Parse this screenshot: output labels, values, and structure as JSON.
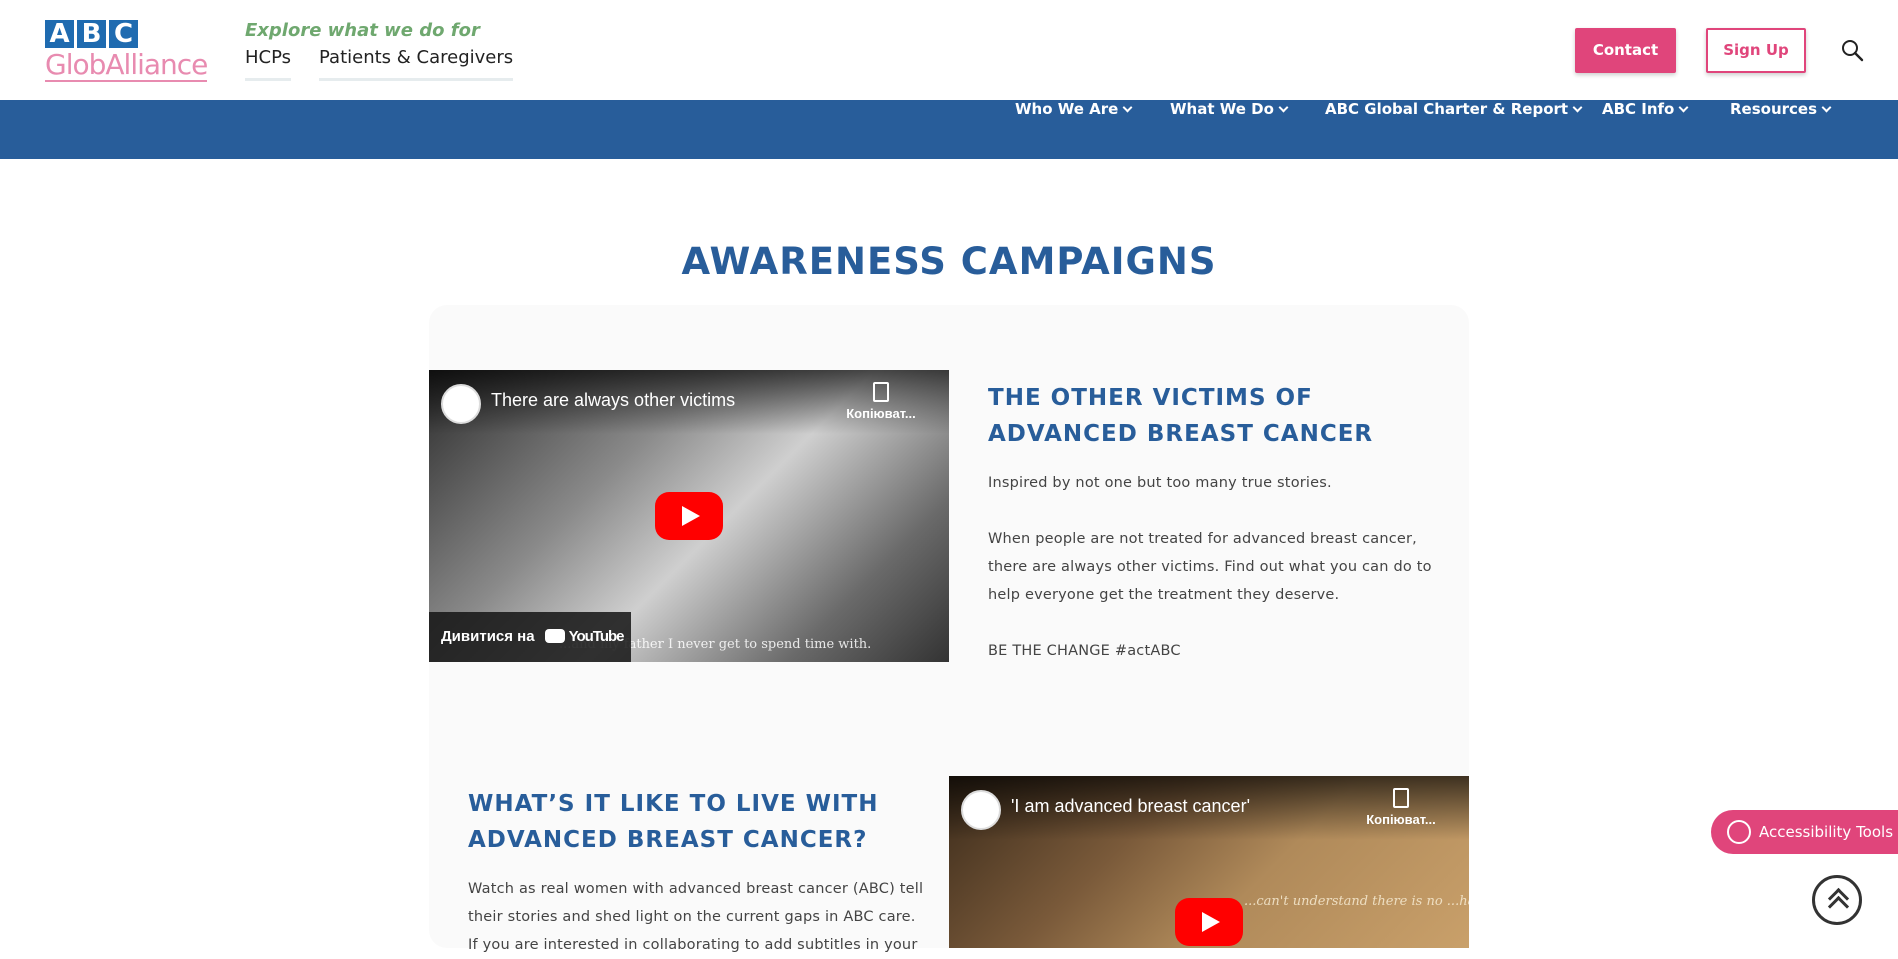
{
  "header": {
    "logo": {
      "top": "ABC",
      "bottom": "GlobAlliance"
    },
    "explore_label": "Explore what we do for",
    "audiences": [
      "HCPs",
      "Patients & Caregivers"
    ],
    "contact_label": "Contact",
    "signup_label": "Sign Up",
    "search_icon": "search-icon"
  },
  "nav": {
    "items": [
      {
        "label": "Who We Are"
      },
      {
        "label": "What We Do"
      },
      {
        "label": "ABC Global Charter & Report"
      },
      {
        "label": "ABC Info"
      },
      {
        "label": "Resources"
      }
    ]
  },
  "main": {
    "title": "AWARENESS CAMPAIGNS",
    "campaigns": [
      {
        "video": {
          "title": "There are always other victims",
          "copy_label": "Копіюват...",
          "watch_label": "Дивитися на",
          "youtube_label": "YouTube",
          "subtitle": "...and my father I never get to spend time with."
        },
        "heading_line1": "THE OTHER VICTIMS OF",
        "heading_line2": "ADVANCED BREAST CANCER",
        "para1": "Inspired by not one but too many true stories.",
        "para2_l1": "When people are not treated for advanced breast cancer,",
        "para2_l2": "there are always other victims. Find out what you can do to",
        "para2_l3": "help everyone get the treatment they deserve.",
        "para3": "BE THE CHANGE #actABC"
      },
      {
        "video": {
          "title": "'I am advanced breast cancer'",
          "copy_label": "Копіюват...",
          "subtitle": "...can't understand there is no ...happy ending....no getting better"
        },
        "heading_line1": "WHAT’S IT LIKE TO LIVE WITH",
        "heading_line2": "ADVANCED BREAST CANCER?",
        "para1_l1": "Watch as real women with advanced breast cancer (ABC) tell",
        "para1_l2": "their stories and shed light on the current gaps in ABC care.",
        "para1_l3": "If you are interested in collaborating to add subtitles in your"
      }
    ]
  },
  "floating": {
    "accessibility_label": "Accessibility Tools",
    "accessibility_icon": "accessibility-icon",
    "back_to_top_icon": "chevron-up-icon"
  },
  "colors": {
    "brand_blue": "#285d9a",
    "brand_pink": "#e0457b",
    "explore_green": "#6fa86f"
  }
}
